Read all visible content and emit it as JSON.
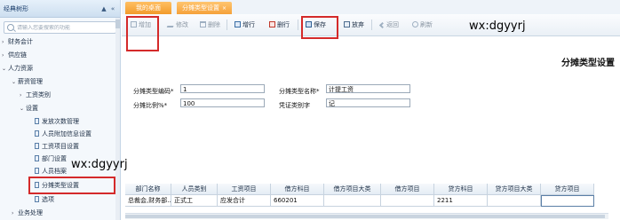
{
  "sidebar": {
    "title": "经典树形",
    "search_placeholder": "请输入您要搜索的功能",
    "items": [
      {
        "label": "财务会计",
        "arrow": "›"
      },
      {
        "label": "供应链",
        "arrow": "›"
      },
      {
        "label": "人力资源",
        "arrow": "⌄"
      },
      {
        "label": "薪资管理",
        "arrow": "⌄"
      },
      {
        "label": "工资类别",
        "arrow": "›"
      },
      {
        "label": "设置",
        "arrow": "⌄"
      },
      {
        "label": "发放次数管理"
      },
      {
        "label": "人员附加信息设置"
      },
      {
        "label": "工资项目设置"
      },
      {
        "label": "部门设置"
      },
      {
        "label": "人员档案"
      },
      {
        "label": "分摊类型设置"
      },
      {
        "label": "选项"
      },
      {
        "label": "业务处理",
        "arrow": "›"
      }
    ]
  },
  "tabs": [
    {
      "label": "我的桌面"
    },
    {
      "label": "分摊类型设置",
      "close": "×"
    }
  ],
  "toolbar": {
    "add": "增加",
    "edit": "修改",
    "delete": "删除",
    "insert_row": "增行",
    "delete_row": "删行",
    "save": "保存",
    "discard": "放弃",
    "back": "返回",
    "refresh": "刷新"
  },
  "watermark": "wx:dgyyrj",
  "form": {
    "title": "分摊类型设置",
    "code_label": "分摊类型编码*",
    "code_value": "1",
    "name_label": "分摊类型名称*",
    "name_value": "计提工资",
    "ratio_label": "分摊比例%*",
    "ratio_value": "100",
    "voucher_label": "凭证类别字",
    "voucher_value": "记"
  },
  "grid": {
    "headers": [
      "部门名称",
      "人员类别",
      "工资项目",
      "借方科目",
      "借方项目大类",
      "借方项目",
      "贷方科目",
      "贷方项目大类",
      "贷方项目"
    ],
    "rows": [
      [
        "总裁会,财务部...",
        "正式工",
        "应发合计",
        "660201",
        "",
        "",
        "2211",
        "",
        ""
      ]
    ]
  }
}
